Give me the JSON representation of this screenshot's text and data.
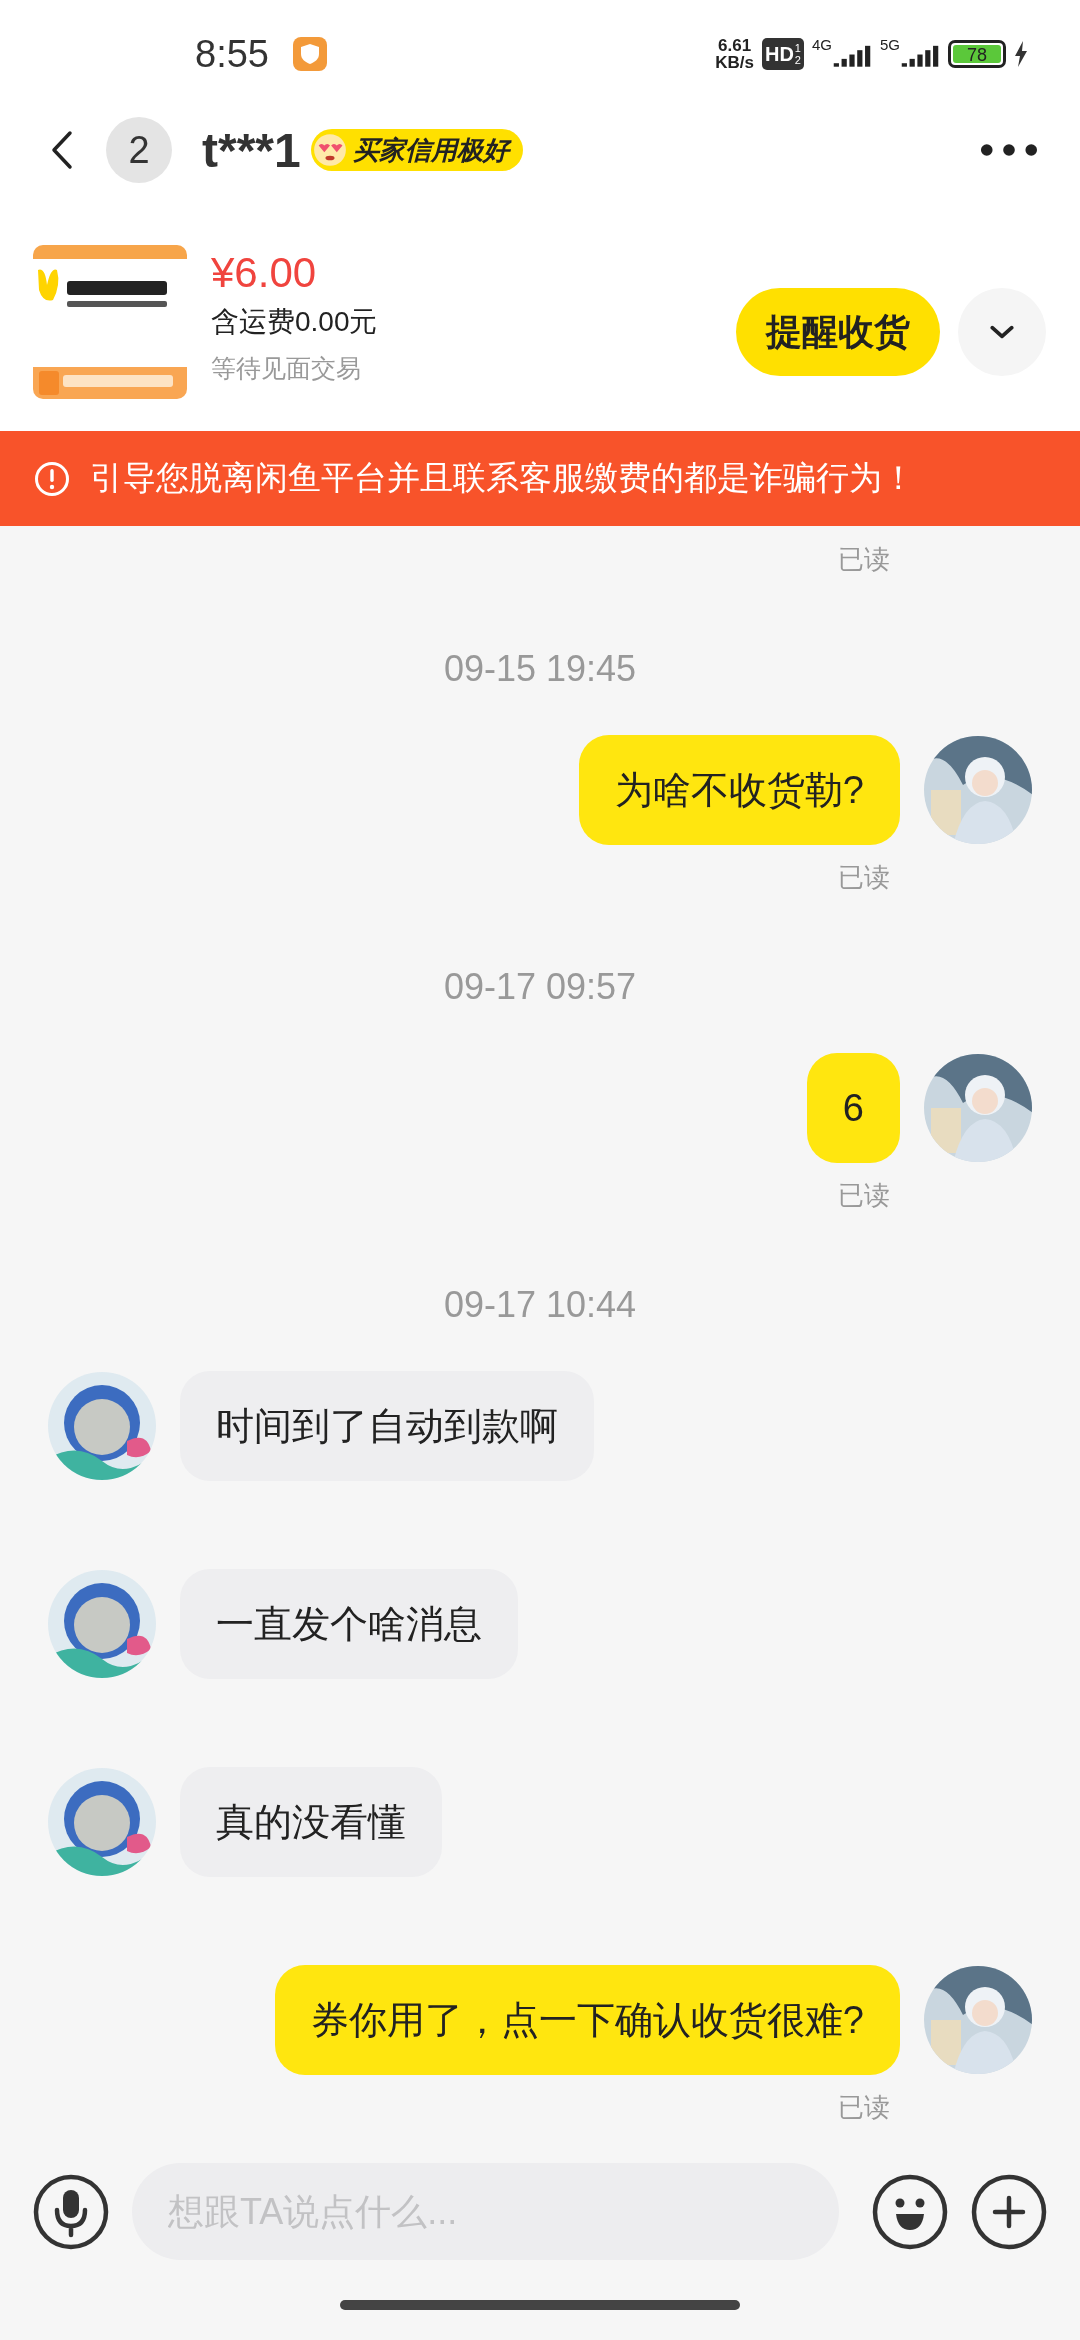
{
  "status_bar": {
    "time": "8:55",
    "speed_value": "6.61",
    "speed_unit": "KB/s",
    "hd": "HD",
    "hd_sup": "1",
    "hd_sub": "2",
    "net_1": "4G",
    "net_2": "5G",
    "battery": "78"
  },
  "header": {
    "unread_count": "2",
    "name": "t***1",
    "credit_badge": "买家信用极好"
  },
  "product": {
    "price": "¥6.00",
    "shipping": "含运费0.00元",
    "status": "等待见面交易",
    "action": "提醒收货"
  },
  "warning": "引导您脱离闲鱼平台并且联系客服缴费的都是诈骗行为！",
  "messages": [
    {
      "kind": "read",
      "text": "已读"
    },
    {
      "kind": "time",
      "text": "09-15 19:45"
    },
    {
      "kind": "sent",
      "text": "为啥不收货勒?"
    },
    {
      "kind": "read",
      "text": "已读"
    },
    {
      "kind": "time",
      "text": "09-17 09:57"
    },
    {
      "kind": "sent",
      "text": "6"
    },
    {
      "kind": "read",
      "text": "已读"
    },
    {
      "kind": "time",
      "text": "09-17 10:44"
    },
    {
      "kind": "received",
      "text": "时间到了自动到款啊"
    },
    {
      "kind": "received",
      "text": "一直发个啥消息"
    },
    {
      "kind": "received",
      "text": "真的没看懂"
    },
    {
      "kind": "sent",
      "text": "券你用了，点一下确认收货很难?"
    },
    {
      "kind": "read",
      "text": "已读"
    }
  ],
  "input": {
    "placeholder": "想跟TA说点什么..."
  }
}
